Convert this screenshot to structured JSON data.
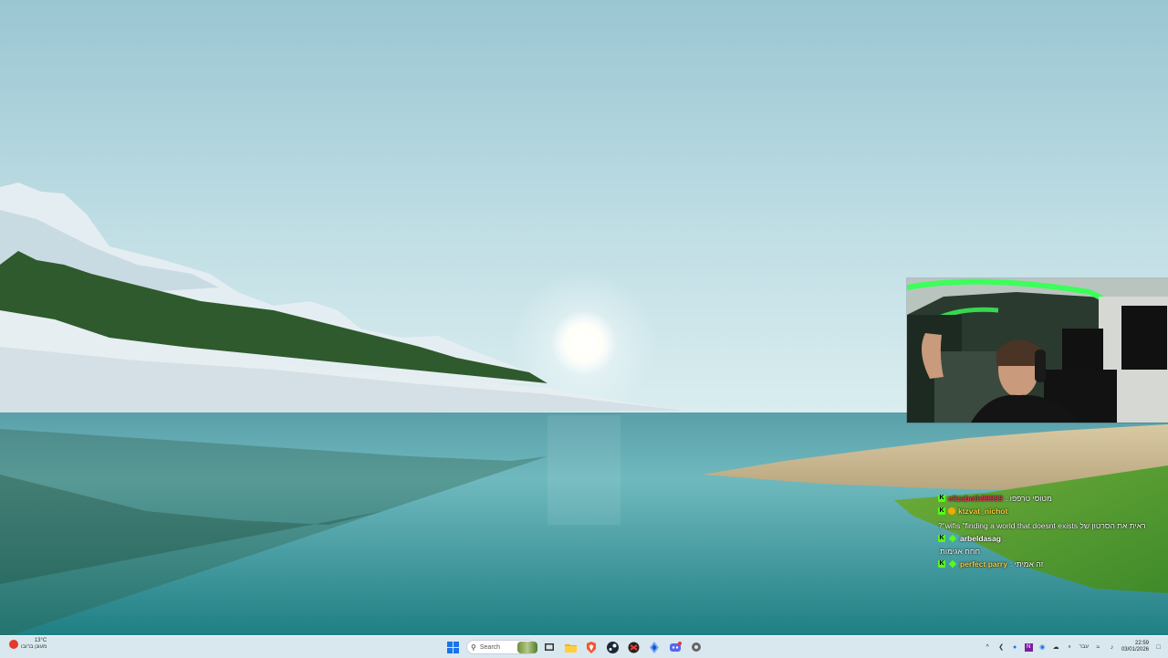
{
  "colors": {
    "sky_top": "#9ec9d4",
    "sky_bottom": "#cfe6ea",
    "water": "#2f8f92",
    "kick_green": "#53fc18",
    "taskbar_bg": "#dae8ee"
  },
  "chat": {
    "messages": [
      {
        "user": "elizabeth99999",
        "user_color": "#e23b5a",
        "text": "מטוסי טרפפו :",
        "badges": [
          "kick-badge"
        ]
      },
      {
        "user": "ktzvat_nichot",
        "user_color": "#ffd23f",
        "text": "ראית את הסרטון של wifis \"finding a world that doesnt exists\"?",
        "badges": [
          "kick-badge",
          "coin-badge"
        ]
      },
      {
        "user": "arbeldasag",
        "user_color": "#ffffff",
        "text": ":",
        "badges": [
          "kick-badge",
          "diamond-badge"
        ]
      },
      {
        "user": "",
        "user_color": "#ffffff",
        "text": "חחח אגימות",
        "badges": []
      },
      {
        "user": "perfect parry",
        "user_color": "#ffd23f",
        "text": "זה אמיתי :",
        "badges": [
          "kick-badge",
          "diamond-badge"
        ]
      }
    ]
  },
  "taskbar": {
    "weather_temp": "13°C",
    "weather_desc": "מעונן ברובו",
    "search_placeholder": "Search",
    "icons": [
      "windows-start-icon",
      "search-icon",
      "task-view-icon",
      "file-explorer-icon",
      "brave-browser-icon",
      "steam-icon",
      "app-red-icon",
      "app-blue-icon",
      "discord-icon",
      "settings-icon"
    ],
    "tray_lang": "עבר",
    "time": "22:59",
    "date": "03/01/2026"
  }
}
